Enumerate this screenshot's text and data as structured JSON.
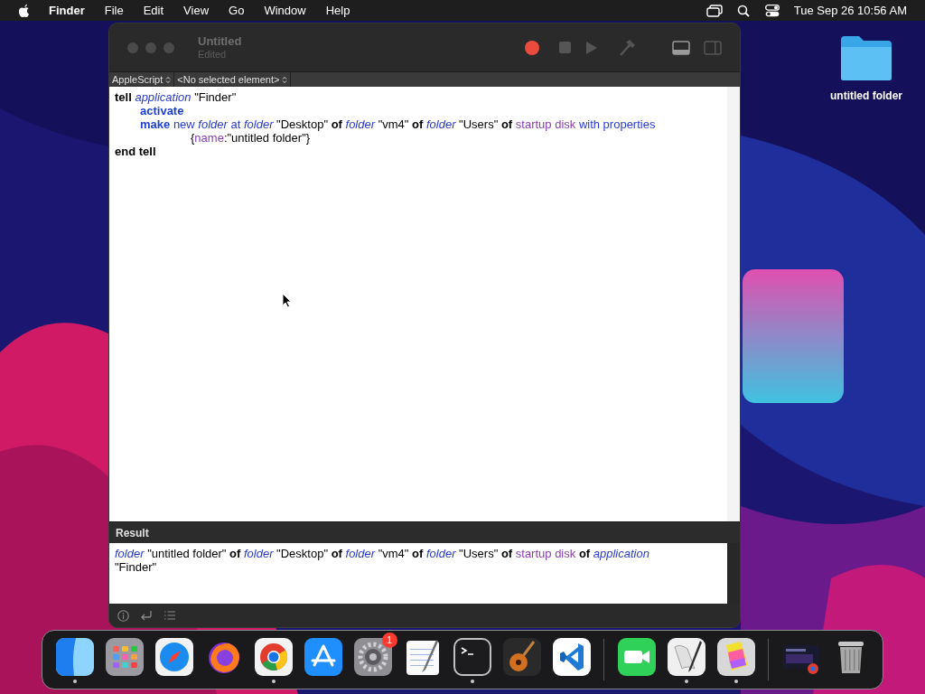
{
  "menubar": {
    "app": "Finder",
    "menus": [
      "File",
      "Edit",
      "View",
      "Go",
      "Window",
      "Help"
    ],
    "clock": "Tue Sep 26 10:56 AM"
  },
  "desktop": {
    "items": [
      {
        "label": "untitled folder"
      }
    ]
  },
  "window": {
    "title": "Untitled",
    "subtitle": "Edited",
    "navigation": [
      "AppleScript",
      "<No selected element>"
    ],
    "script": [
      [
        {
          "kind": "keyword",
          "text": "tell "
        },
        {
          "kind": "class",
          "text": "application"
        },
        {
          "kind": "text",
          "text": " \"Finder\""
        }
      ],
      [
        {
          "kind": "command",
          "text": "\tactivate"
        }
      ],
      [
        {
          "kind": "command",
          "text": "\tmake "
        },
        {
          "kind": "parameter",
          "text": "new "
        },
        {
          "kind": "class",
          "text": "folder "
        },
        {
          "kind": "parameter",
          "text": "at "
        },
        {
          "kind": "class",
          "text": "folder"
        },
        {
          "kind": "text",
          "text": " \"Desktop\" "
        },
        {
          "kind": "keyword",
          "text": "of "
        },
        {
          "kind": "class",
          "text": "folder"
        },
        {
          "kind": "text",
          "text": " \"vm4\" "
        },
        {
          "kind": "keyword",
          "text": "of "
        },
        {
          "kind": "class",
          "text": "folder"
        },
        {
          "kind": "text",
          "text": " \"Users\" "
        },
        {
          "kind": "keyword",
          "text": "of "
        },
        {
          "kind": "property",
          "text": "startup disk "
        },
        {
          "kind": "parameter",
          "text": "with properties"
        }
      ],
      [
        {
          "kind": "text",
          "text": "\t\t\t{"
        },
        {
          "kind": "property",
          "text": "name"
        },
        {
          "kind": "text",
          "text": ":\"untitled folder\"}"
        }
      ],
      [
        {
          "kind": "keyword",
          "text": "end tell"
        }
      ]
    ],
    "result_label": "Result",
    "result": [
      {
        "kind": "class",
        "text": "folder"
      },
      {
        "kind": "text",
        "text": " \"untitled folder\" "
      },
      {
        "kind": "keyword",
        "text": "of "
      },
      {
        "kind": "class",
        "text": "folder"
      },
      {
        "kind": "text",
        "text": " \"Desktop\" "
      },
      {
        "kind": "keyword",
        "text": "of "
      },
      {
        "kind": "class",
        "text": "folder"
      },
      {
        "kind": "text",
        "text": " \"vm4\" "
      },
      {
        "kind": "keyword",
        "text": "of "
      },
      {
        "kind": "class",
        "text": "folder"
      },
      {
        "kind": "text",
        "text": " \"Users\" "
      },
      {
        "kind": "keyword",
        "text": "of "
      },
      {
        "kind": "property",
        "text": "startup disk "
      },
      {
        "kind": "keyword",
        "text": "of "
      },
      {
        "kind": "class",
        "text": "application"
      },
      {
        "kind": "text",
        "text": " \"Finder\""
      }
    ]
  },
  "dock": {
    "groups": [
      [
        {
          "running": true
        },
        {
          "running": false
        },
        {
          "running": false
        },
        {
          "running": false
        },
        {
          "running": true
        },
        {
          "running": false
        },
        {
          "running": false,
          "badge": "1"
        },
        {
          "running": false
        },
        {
          "running": true
        },
        {
          "running": false
        },
        {
          "running": false
        }
      ],
      [
        {
          "running": false
        },
        {
          "running": true
        },
        {
          "running": true
        }
      ],
      [
        {
          "running": false
        },
        {
          "running": false
        }
      ]
    ]
  }
}
